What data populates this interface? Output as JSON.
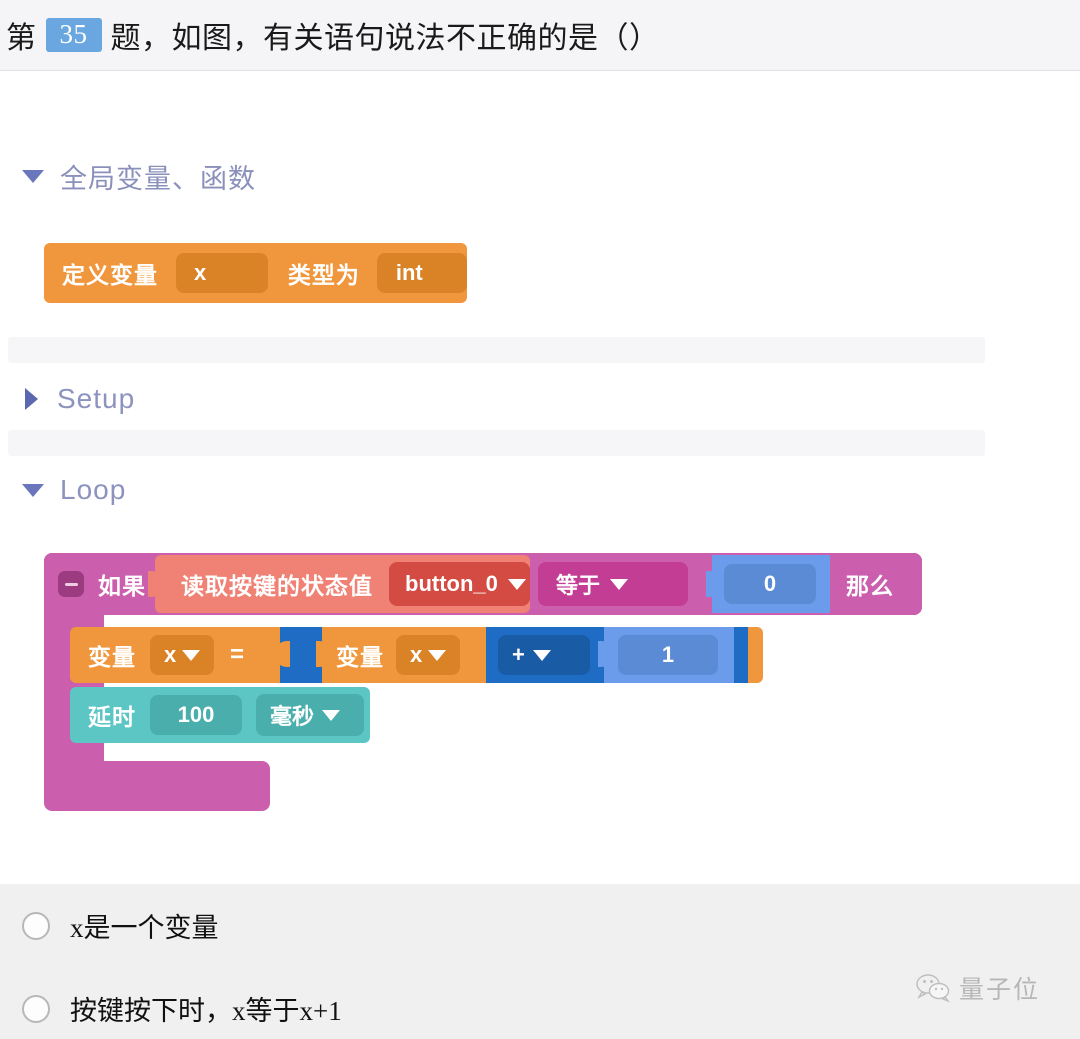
{
  "header": {
    "prefix": "第",
    "question_number": "35",
    "suffix": "题，如图，有关语句说法不正确的是（）",
    "number_badge_color": "#6aa7e0"
  },
  "workspace": {
    "sections": [
      {
        "name": "globals",
        "label": "全局变量、函数",
        "expanded": true,
        "toggle_icon": "triangle-down-icon"
      },
      {
        "name": "setup",
        "label": "Setup",
        "expanded": false,
        "toggle_icon": "triangle-right-icon"
      },
      {
        "name": "loop",
        "label": "Loop",
        "expanded": true,
        "toggle_icon": "triangle-down-icon"
      }
    ],
    "define_block": {
      "label_1": "定义变量",
      "variable": "x",
      "label_2": "类型为",
      "type": "int",
      "color": "#f0963c"
    },
    "if_block": {
      "collapse_icon": "minus-icon",
      "if_label": "如果",
      "then_label": "那么",
      "color": "#cb5fae",
      "condition": {
        "sensor_label": "读取按键的状态值",
        "sensor_pin": "button_0",
        "sensor_color": "#f08275",
        "operator": "等于",
        "operator_color": "#cb5fae",
        "compare_value": "0",
        "value_color": "#6a9ceb"
      },
      "body": [
        {
          "type": "assignment",
          "label": "变量",
          "target": "x",
          "equals": "=",
          "operand_label": "变量",
          "operand": "x",
          "operator": "+",
          "addend": "1",
          "color": "#f0963c"
        },
        {
          "type": "delay",
          "label": "延时",
          "value": "100",
          "unit": "毫秒",
          "color": "#5bc6c4"
        }
      ]
    }
  },
  "options": [
    {
      "id": "A",
      "text": "x是一个变量",
      "selected": false
    },
    {
      "id": "B",
      "text": "按键按下时，x等于x+1",
      "selected": false
    }
  ],
  "watermark": {
    "icon": "wechat-icon",
    "text": "量子位"
  }
}
